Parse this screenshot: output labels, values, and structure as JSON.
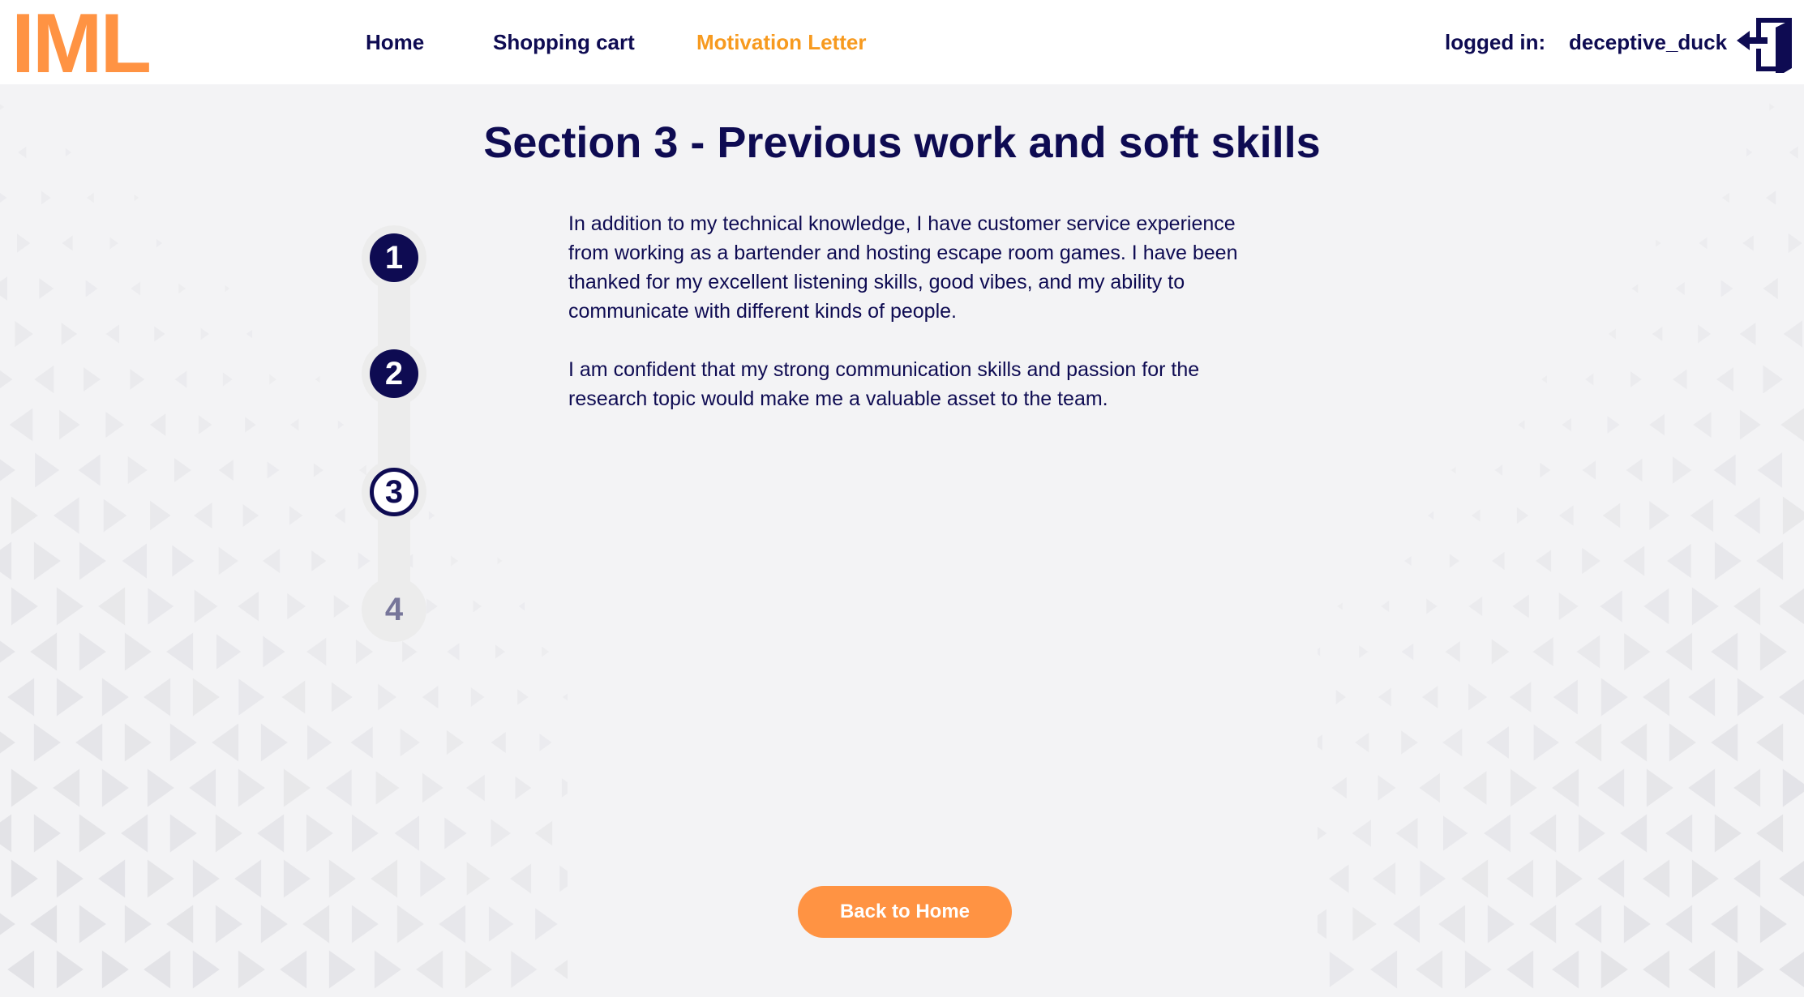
{
  "header": {
    "logo_text": "IML",
    "nav": {
      "home": "Home",
      "shopping_cart": "Shopping cart",
      "motivation_letter": "Motivation Letter"
    },
    "active_nav": "motivation_letter",
    "login_label": "logged in:",
    "username": "deceptive_duck",
    "logout_icon": "logout-door-icon"
  },
  "page": {
    "title": "Section 3 - Previous work and soft skills"
  },
  "stepper": {
    "steps": [
      {
        "label": "1",
        "state": "done"
      },
      {
        "label": "2",
        "state": "done"
      },
      {
        "label": "3",
        "state": "current"
      },
      {
        "label": "4",
        "state": "todo"
      }
    ]
  },
  "content": {
    "paragraphs": [
      "In addition to my technical knowledge, I have customer service experience from working as a bartender and hosting escape room games. I have been thanked for my excellent listening skills, good vibes, and my ability to communicate with different kinds of people.",
      "I am confident that my strong communication skills and passion for the research topic would make me a valuable asset to the team."
    ]
  },
  "footer": {
    "back_button": "Back to Home"
  },
  "colors": {
    "brand_orange": "#ff9343",
    "active_nav": "#f79a1f",
    "navy": "#0e0b52",
    "background": "#f3f3f5"
  }
}
